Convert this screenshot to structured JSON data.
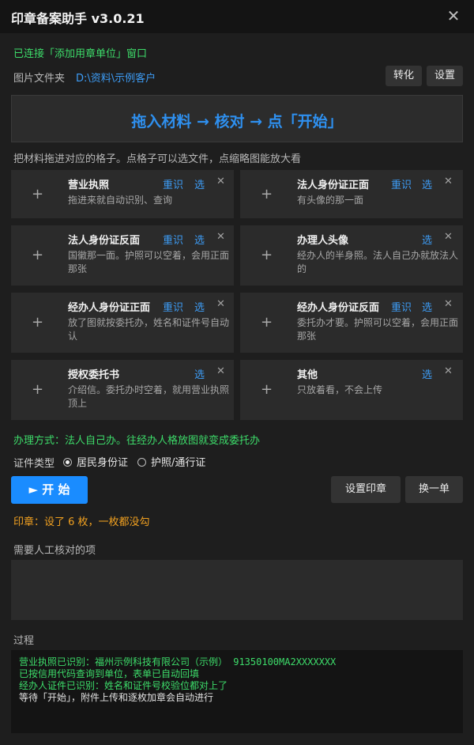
{
  "window": {
    "title": "印章备案助手 v3.0.21",
    "close_glyph": "✕"
  },
  "status": {
    "connected": "已连接「添加用章单位」窗口"
  },
  "folder": {
    "label": "图片文件夹",
    "path": "D:\\资料\\示例客户"
  },
  "toolbar": {
    "convert_label": "转化",
    "settings_label": "设置"
  },
  "dropzone": {
    "text": "拖入材料 → 核对 → 点「开始」"
  },
  "hint": "把材料拖进对应的格子。点格子可以选文件，点缩略图能放大看",
  "cards": [
    {
      "title": "营业执照",
      "desc": "拖进来就自动识别、查询",
      "recognize": "重识",
      "select": "选",
      "close": "✕"
    },
    {
      "title": "法人身份证正面",
      "desc": "有头像的那一面",
      "recognize": "重识",
      "select": "选",
      "close": "✕"
    },
    {
      "title": "法人身份证反面",
      "desc": "国徽那一面。护照可以空着，会用正面那张",
      "recognize": "重识",
      "select": "选",
      "close": "✕"
    },
    {
      "title": "办理人头像",
      "desc": "经办人的半身照。法人自己办就放法人的",
      "recognize": "",
      "select": "选",
      "close": "✕"
    },
    {
      "title": "经办人身份证正面",
      "desc": "放了图就按委托办，姓名和证件号自动认",
      "recognize": "重识",
      "select": "选",
      "close": "✕"
    },
    {
      "title": "经办人身份证反面",
      "desc": "委托办才要。护照可以空着，会用正面那张",
      "recognize": "重识",
      "select": "选",
      "close": "✕"
    },
    {
      "title": "授权委托书",
      "desc": "介绍信。委托办时空着，就用营业执照顶上",
      "recognize": "",
      "select": "选",
      "close": "✕"
    },
    {
      "title": "其他",
      "desc": "只放着看，不会上传",
      "recognize": "",
      "select": "选",
      "close": "✕"
    }
  ],
  "card_plus": "+",
  "handling": "办理方式：法人自己办。往经办人格放图就变成委托办",
  "id_type": {
    "label": "证件类型",
    "options": [
      "居民身份证",
      "护照/通行证"
    ],
    "selected": "居民身份证"
  },
  "actions": {
    "start": "► 开 始",
    "set_seal": "设置印章",
    "next_order": "换一单"
  },
  "seal_status": "印章：设了 6 枚，一枚都没勾",
  "manual_check": {
    "label": "需要人工核对的项"
  },
  "process": {
    "label": "过程",
    "log": [
      {
        "text": "营业执照已识别：福州示例科技有限公司（示例） 91350100MA2XXXXXXX",
        "color": "#3ddc6a"
      },
      {
        "text": "已按信用代码查询到单位，表单已自动回填",
        "color": "#3ddc6a"
      },
      {
        "text": "经办人证件已识别：姓名和证件号校验位都对上了",
        "color": "#3ddc6a"
      },
      {
        "text": "等待「开始」，附件上传和逐枚加章会自动进行",
        "color": "#e0e0e0"
      }
    ]
  },
  "colors": {
    "accent_blue": "#1a8cff",
    "link_blue": "#3d9cf5",
    "ok_green": "#3ddc6a",
    "warn_orange": "#f0a020",
    "background": "#1e1e1e",
    "card": "#2b2b2b"
  }
}
